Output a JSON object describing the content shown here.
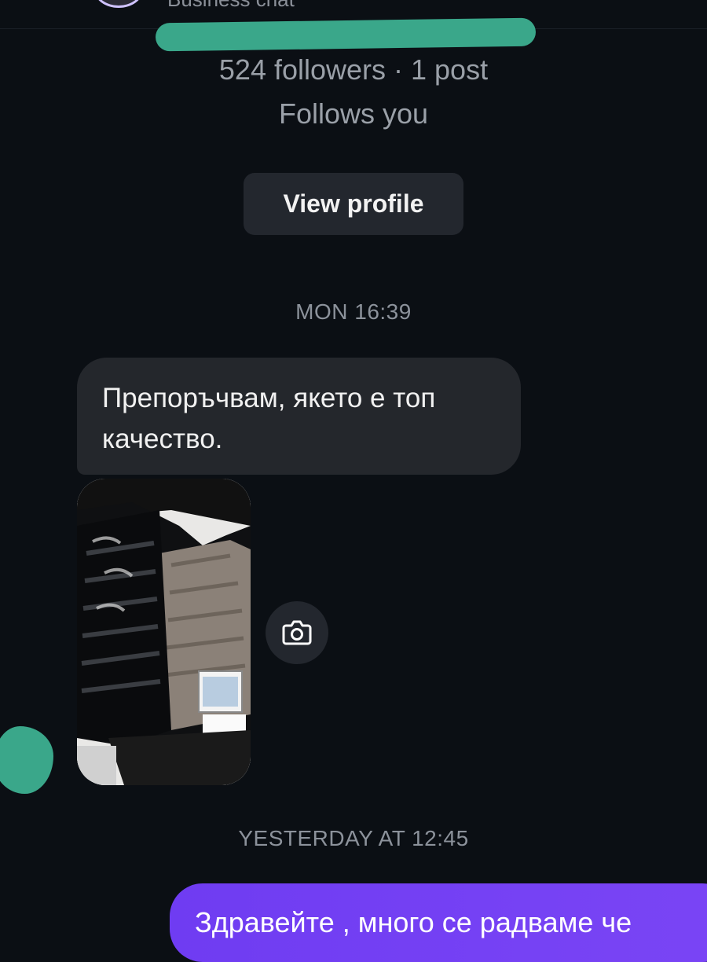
{
  "header": {
    "subtitle": "Business chat"
  },
  "profile": {
    "followers_line": "524 followers · 1 post",
    "follows_you": "Follows you",
    "view_profile_label": "View profile"
  },
  "conversation": {
    "timestamps": [
      "MON 16:39",
      "YESTERDAY AT 12:45"
    ],
    "incoming_message": "Препоръчвам, якето е топ качество.",
    "photo_icon": "camera-icon",
    "outgoing_message": "Здравейте , много се радваме че"
  },
  "colors": {
    "background": "#0b0f14",
    "incoming_bubble": "#24272c",
    "outgoing_bubble": "#7041f4",
    "redaction": "#3aa78a"
  }
}
